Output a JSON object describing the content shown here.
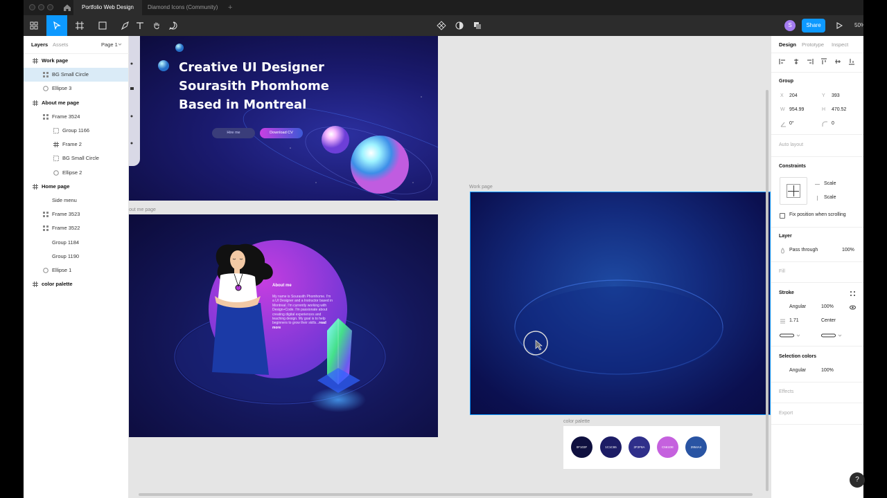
{
  "tabs": [
    {
      "label": "Portfolio Web Design",
      "active": true
    },
    {
      "label": "Diamond Icons (Community)",
      "active": false
    }
  ],
  "toolbar": {
    "tools": [
      "move-tool",
      "frame-tool",
      "shape-tool",
      "pen-tool",
      "text-tool",
      "hand-tool",
      "comment-tool"
    ],
    "avatar_initial": "S",
    "share_label": "Share",
    "zoom": "50%"
  },
  "layers_panel": {
    "tab_layers": "Layers",
    "tab_assets": "Assets",
    "page_selector": "Page 1",
    "items": [
      {
        "label": "Work page",
        "icon": "frame-icon",
        "level": 0,
        "bold": true
      },
      {
        "label": "BG Small Circle",
        "icon": "component-icon",
        "level": 1,
        "selected": true
      },
      {
        "label": "Ellipse 3",
        "icon": "ellipse-icon",
        "level": 1
      },
      {
        "label": "About me page",
        "icon": "frame-icon",
        "level": 0,
        "bold": true
      },
      {
        "label": "Frame 3524",
        "icon": "component-icon",
        "level": 1
      },
      {
        "label": "Group 1166",
        "icon": "group-icon",
        "level": 2
      },
      {
        "label": "Frame 2",
        "icon": "frame-icon",
        "level": 2
      },
      {
        "label": "BG Small Circle",
        "icon": "group-icon",
        "level": 2
      },
      {
        "label": "Ellipse 2",
        "icon": "ellipse-icon",
        "level": 2
      },
      {
        "label": "Home page",
        "icon": "frame-icon",
        "level": 0,
        "bold": true
      },
      {
        "label": "Side menu",
        "icon": "none",
        "level": 1
      },
      {
        "label": "Frame 3523",
        "icon": "component-icon",
        "level": 1
      },
      {
        "label": "Frame 3522",
        "icon": "component-icon",
        "level": 1
      },
      {
        "label": "Group 1184",
        "icon": "none",
        "level": 1
      },
      {
        "label": "Group 1190",
        "icon": "none",
        "level": 1
      },
      {
        "label": "Ellipse 1",
        "icon": "ellipse-icon",
        "level": 1
      },
      {
        "label": "color palette",
        "icon": "frame-icon",
        "level": 0,
        "bold": true
      }
    ]
  },
  "canvas": {
    "home": {
      "hero_lines": [
        "Creative UI Designer",
        "Sourasith Phomhome",
        "Based in Montreal"
      ],
      "hire_button": "Hire me",
      "cv_button": "Download CV"
    },
    "about": {
      "frame_label": "out me page",
      "title": "About me",
      "body": "My name is Sourasith Phomhome. I'm a UI Designer and a Instructor based in Montreal. I'm currently working with Design+Code. I'm passionate about creating digital experiences and teaching design. My goal is to help beginners to grow their skills...",
      "read_more": "read more"
    },
    "work": {
      "frame_label": "Work page"
    },
    "palette": {
      "frame_label": "color palette",
      "swatches": [
        {
          "hex": "0F103F",
          "color": "#0f103f"
        },
        {
          "hex": "1C1C65",
          "color": "#1c1c65"
        },
        {
          "hex": "2F2F8A",
          "color": "#2f2f8a"
        },
        {
          "hex": "C561DE",
          "color": "#c561de"
        },
        {
          "hex": "2954A3",
          "color": "#2954a3"
        }
      ]
    }
  },
  "design_panel": {
    "tab_design": "Design",
    "tab_prototype": "Prototype",
    "tab_inspect": "Inspect",
    "group_title": "Group",
    "x_label": "X",
    "x_value": "204",
    "y_label": "Y",
    "y_value": "393",
    "w_label": "W",
    "w_value": "954.99",
    "h_label": "H",
    "h_value": "470.52",
    "rotation": "0°",
    "radius": "0",
    "auto_layout": "Auto layout",
    "constraints_title": "Constraints",
    "constraint_h": "Scale",
    "constraint_v": "Scale",
    "fix_position": "Fix position when scrolling",
    "layer_title": "Layer",
    "blend_mode": "Pass through",
    "layer_opacity": "100%",
    "fill_title": "Fill",
    "stroke_title": "Stroke",
    "stroke_type": "Angular",
    "stroke_opacity": "100%",
    "stroke_weight": "1.71",
    "stroke_position": "Center",
    "selection_colors_title": "Selection colors",
    "selection_color_type": "Angular",
    "selection_color_opacity": "100%",
    "effects_title": "Effects",
    "export_title": "Export"
  }
}
